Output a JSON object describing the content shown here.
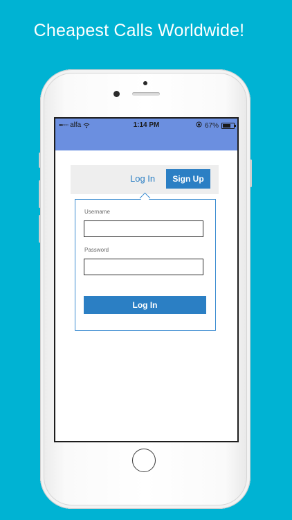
{
  "promo": {
    "title": "Cheapest Calls Worldwide!"
  },
  "status_bar": {
    "carrier": "alfa",
    "signal": "●●○○○",
    "time": "1:14 PM",
    "battery": "67%",
    "icons": [
      "wifi-icon",
      "orientation-lock-icon",
      "battery-icon"
    ]
  },
  "tabs": {
    "login_label": "Log In",
    "signup_label": "Sign Up"
  },
  "form": {
    "username_label": "Username",
    "username_value": "",
    "password_label": "Password",
    "password_value": "",
    "submit_label": "Log In"
  },
  "colors": {
    "background": "#00b3d3",
    "status_bar": "#6b8fe0",
    "accent": "#2b7fc4"
  }
}
